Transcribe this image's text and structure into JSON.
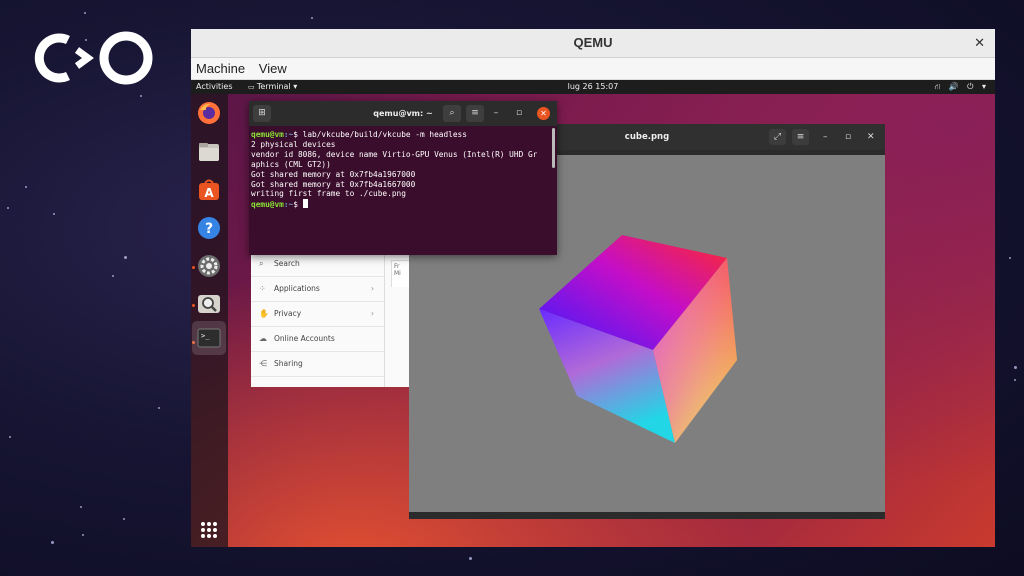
{
  "logo": {
    "name": "collabora-logo"
  },
  "qemu": {
    "title": "QEMU",
    "close_icon": "✕",
    "menu": [
      "Machine",
      "View"
    ]
  },
  "topbar": {
    "activities": "Activities",
    "app_menu": "Terminal ▾",
    "clock": "lug 26  15:07",
    "tray": "⛙ 🔊 ⏻ ▾"
  },
  "dock": {
    "icons": [
      "firefox-icon",
      "files-icon",
      "software-center-icon",
      "help-icon",
      "settings-icon",
      "image-viewer-icon",
      "terminal-icon",
      "show-apps-icon"
    ]
  },
  "settings": {
    "rows": [
      {
        "icon": "search-icon",
        "label": "Search",
        "chevron": ""
      },
      {
        "icon": "applications-icon",
        "label": "Applications",
        "chevron": "›"
      },
      {
        "icon": "privacy-icon",
        "label": "Privacy",
        "chevron": "›"
      },
      {
        "icon": "online-accounts-icon",
        "label": "Online Accounts",
        "chevron": ""
      },
      {
        "icon": "sharing-icon",
        "label": "Sharing",
        "chevron": ""
      }
    ],
    "right_panel": {
      "line1": "Fr",
      "line2": "Mi"
    }
  },
  "viewer": {
    "title": "cube.png",
    "fullscreen_icon": "⤢",
    "menu_icon": "≡",
    "minimize_icon": "–",
    "maximize_icon": "▫",
    "close_icon": "✕"
  },
  "terminal": {
    "title": "qemu@vm: ~",
    "new_tab_icon": "⊞",
    "search_icon": "⌕",
    "menu_icon": "≡",
    "minimize_icon": "–",
    "maximize_icon": "▫",
    "close_icon": "✕",
    "prompt_user": "qemu@vm",
    "prompt_path": ":~",
    "prompt_sigil": "$ ",
    "command": "lab/vkcube/build/vkcube -m headless",
    "output": [
      "2 physical devices",
      "vendor id 8086, device name Virtio-GPU Venus (Intel(R) UHD Gr",
      "aphics (CML GT2))",
      "Got shared memory at 0x7fb4a1967000",
      "Got shared memory at 0x7fb4a1667000",
      "writing first frame to ./cube.png"
    ]
  }
}
